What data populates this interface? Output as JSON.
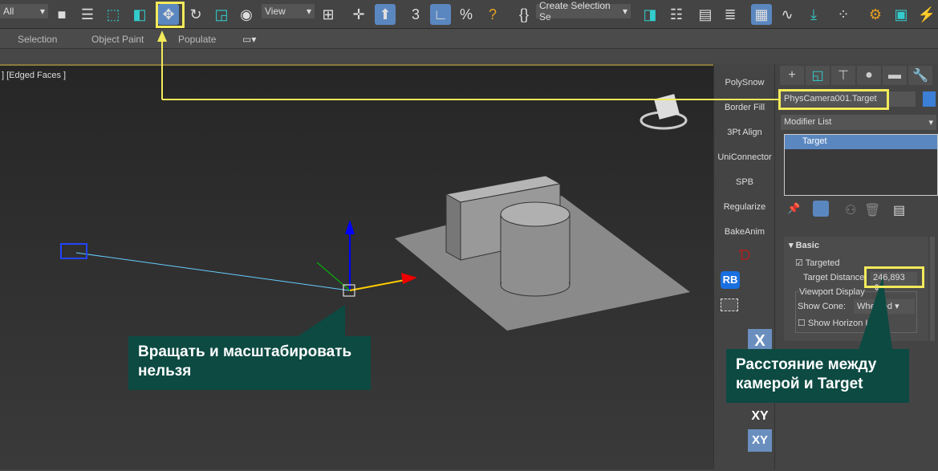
{
  "toolbar": {
    "filter_value": "All",
    "view_value": "View",
    "selection_set_placeholder": "Create Selection Se",
    "icons": [
      "select-object-icon",
      "select-by-name-icon",
      "rect-selection-icon",
      "window-crossing-icon",
      "move-icon",
      "rotate-icon",
      "scale-icon",
      "place-icon",
      "pivot-icon",
      "snap-icon",
      "angle-snap-icon",
      "percent-snap-icon",
      "spinner-snap-icon",
      "edit-named-sets-icon",
      "mirror-icon",
      "align-icon",
      "scene-explorer-icon",
      "layer-explorer-icon",
      "ribbon-icon",
      "curve-editor-icon",
      "schematic-icon",
      "material-editor-icon",
      "render-setup-icon",
      "render-frame-icon",
      "render-icon"
    ]
  },
  "ribbon": {
    "tabs": [
      "Selection",
      "Object Paint",
      "Populate"
    ]
  },
  "viewport": {
    "label": "] [Edged Faces ]"
  },
  "side_buttons": [
    "PolySnow",
    "Border Fill",
    "3Pt Align",
    "UniConnector",
    "SPB",
    "Regularize",
    "BakeAnim"
  ],
  "side_icon_labels": {
    "rb": "RB",
    "x": "X",
    "xy": "XY",
    "xy2": "XY"
  },
  "command_panel": {
    "object_name": "PhysCamera001.Target",
    "object_color": "#3b7fd6",
    "modifier_list": "Modifier List",
    "stack_items": [
      "Target"
    ],
    "rollout_title": "Basic",
    "targeted_label": "Targeted",
    "targeted_checked": true,
    "target_distance_label": "Target Distance:",
    "target_distance_value": "246,893",
    "viewport_display_label": "Viewport Display",
    "show_cone_label": "Show Cone:",
    "show_cone_value": "Whe..ted",
    "show_horizon_label": "Show Horizon Li..."
  },
  "callouts": {
    "left": "Вращать и масштабировать нельзя",
    "right": "Расстояние между камерой и Target"
  },
  "colors": {
    "highlight": "#f2ea5a",
    "callout": "#0c4a42",
    "active": "#5b87c0"
  }
}
